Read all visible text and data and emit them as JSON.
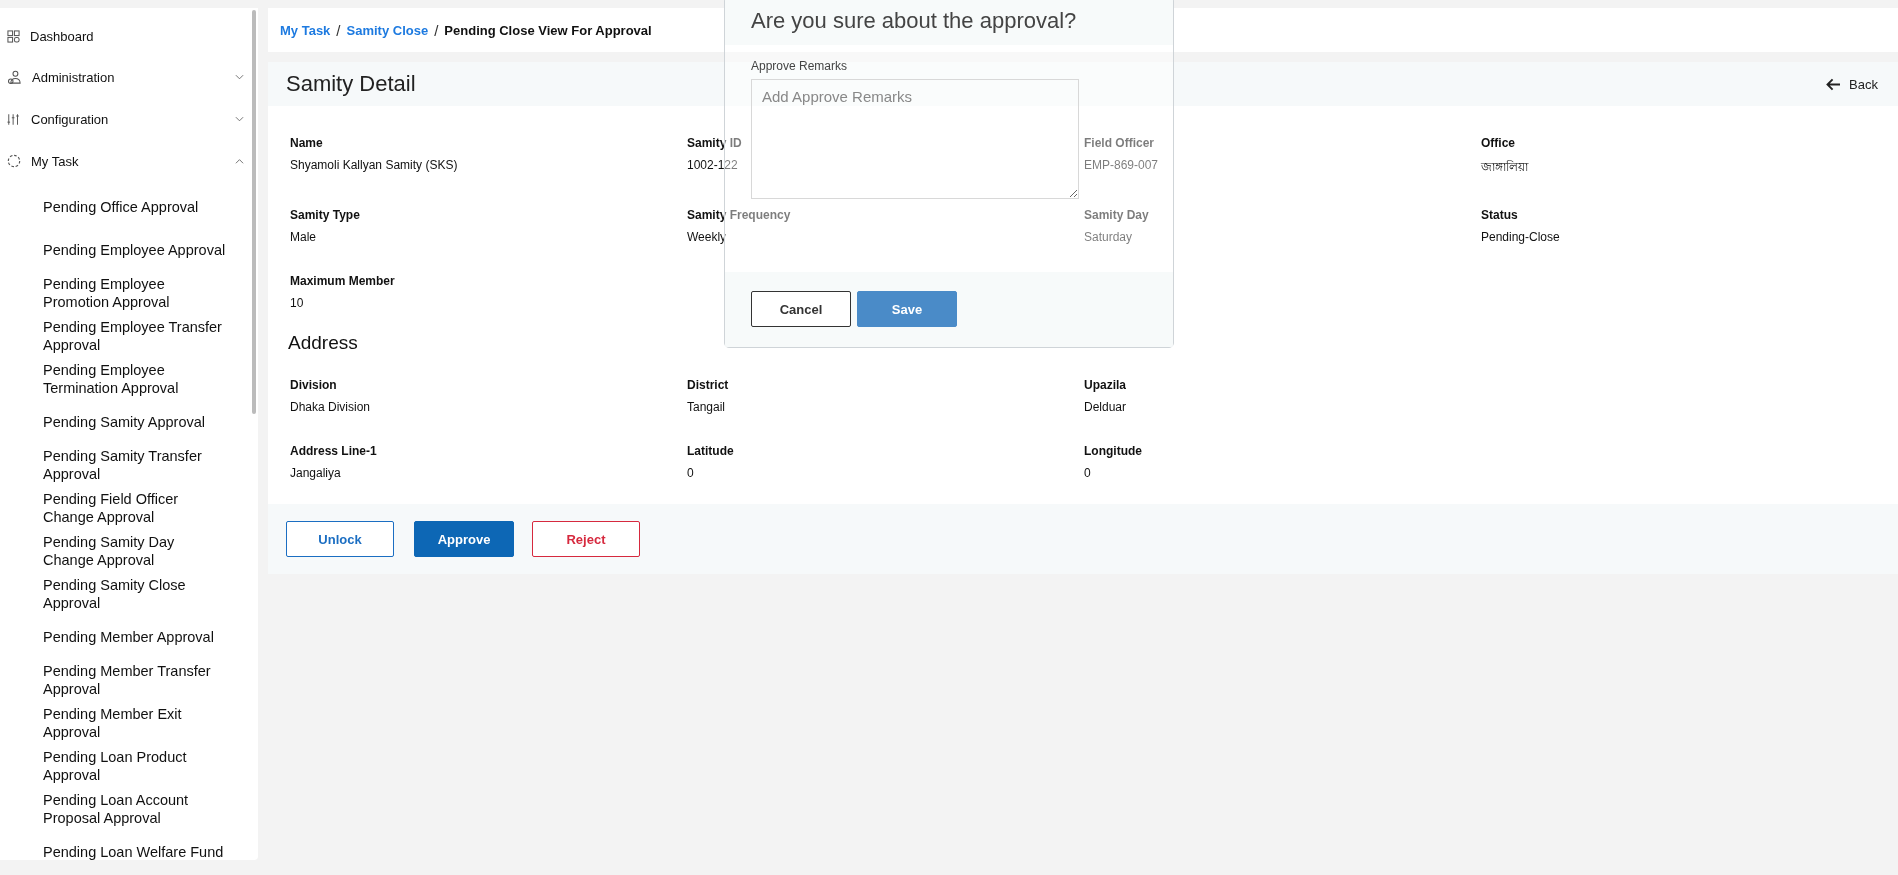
{
  "sidebar": {
    "items": [
      {
        "label": "Dashboard",
        "kind": "link"
      },
      {
        "label": "Administration",
        "kind": "group",
        "expanded": false
      },
      {
        "label": "Configuration",
        "kind": "group",
        "expanded": false
      },
      {
        "label": "My Task",
        "kind": "group",
        "expanded": true,
        "children": [
          {
            "label": "Pending Office Approval"
          },
          {
            "label": "Pending Employee Approval"
          },
          {
            "label": "Pending Employee Promotion Approval"
          },
          {
            "label": "Pending Employee Transfer Approval"
          },
          {
            "label": "Pending Employee Termination Approval"
          },
          {
            "label": "Pending Samity Approval"
          },
          {
            "label": "Pending Samity Transfer Approval"
          },
          {
            "label": "Pending Field Officer Change Approval"
          },
          {
            "label": "Pending Samity Day Change Approval"
          },
          {
            "label": "Pending Samity Close Approval"
          },
          {
            "label": "Pending Member Approval"
          },
          {
            "label": "Pending Member Transfer Approval"
          },
          {
            "label": "Pending Member Exit Approval"
          },
          {
            "label": "Pending Loan Product Approval"
          },
          {
            "label": "Pending Loan Account Proposal Approval"
          },
          {
            "label": "Pending Loan Welfare Fund"
          }
        ]
      }
    ]
  },
  "breadcrumb": [
    {
      "label": "My Task",
      "kind": "link"
    },
    {
      "label": "/",
      "kind": "separator"
    },
    {
      "label": "Samity Close",
      "kind": "link"
    },
    {
      "label": "/",
      "kind": "separator"
    },
    {
      "label": "Pending Close View For Approval",
      "kind": "current"
    }
  ],
  "detail": {
    "title": "Samity Detail",
    "back": "Back",
    "fields": [
      {
        "label": "Name",
        "value": "Shyamoli Kallyan Samity (SKS)"
      },
      {
        "label": "Samity ID",
        "value": "1002-122"
      },
      {
        "label": "Field Officer",
        "value": "EMP-869-007"
      },
      {
        "label": "Office",
        "value": "জাঙ্গালিয়া"
      },
      {
        "label": "Samity Type",
        "value": "Male"
      },
      {
        "label": "Samity Frequency",
        "value": "Weekly"
      },
      {
        "label": "Samity Day",
        "value": "Saturday"
      },
      {
        "label": "Status",
        "value": "Pending-Close"
      },
      {
        "label": "Maximum Member",
        "value": "10"
      }
    ],
    "address_title": "Address",
    "address_fields": [
      {
        "label": "Division",
        "value": "Dhaka Division"
      },
      {
        "label": "District",
        "value": "Tangail"
      },
      {
        "label": "Upazila",
        "value": "Delduar"
      },
      {
        "label": "Address Line-1",
        "value": "Jangaliya"
      },
      {
        "label": "Latitude",
        "value": "0"
      },
      {
        "label": "Longitude",
        "value": "0"
      }
    ],
    "actions": [
      {
        "label": "Unlock",
        "kind": "outline"
      },
      {
        "label": "Approve",
        "kind": "primary"
      },
      {
        "label": "Reject",
        "kind": "danger"
      }
    ]
  },
  "modal": {
    "title": "Are you sure about the approval?",
    "field_label": "Approve Remarks",
    "placeholder": "Add Approve Remarks",
    "buttons": [
      {
        "label": "Cancel",
        "kind": "outline"
      },
      {
        "label": "Save",
        "kind": "primary"
      }
    ]
  }
}
